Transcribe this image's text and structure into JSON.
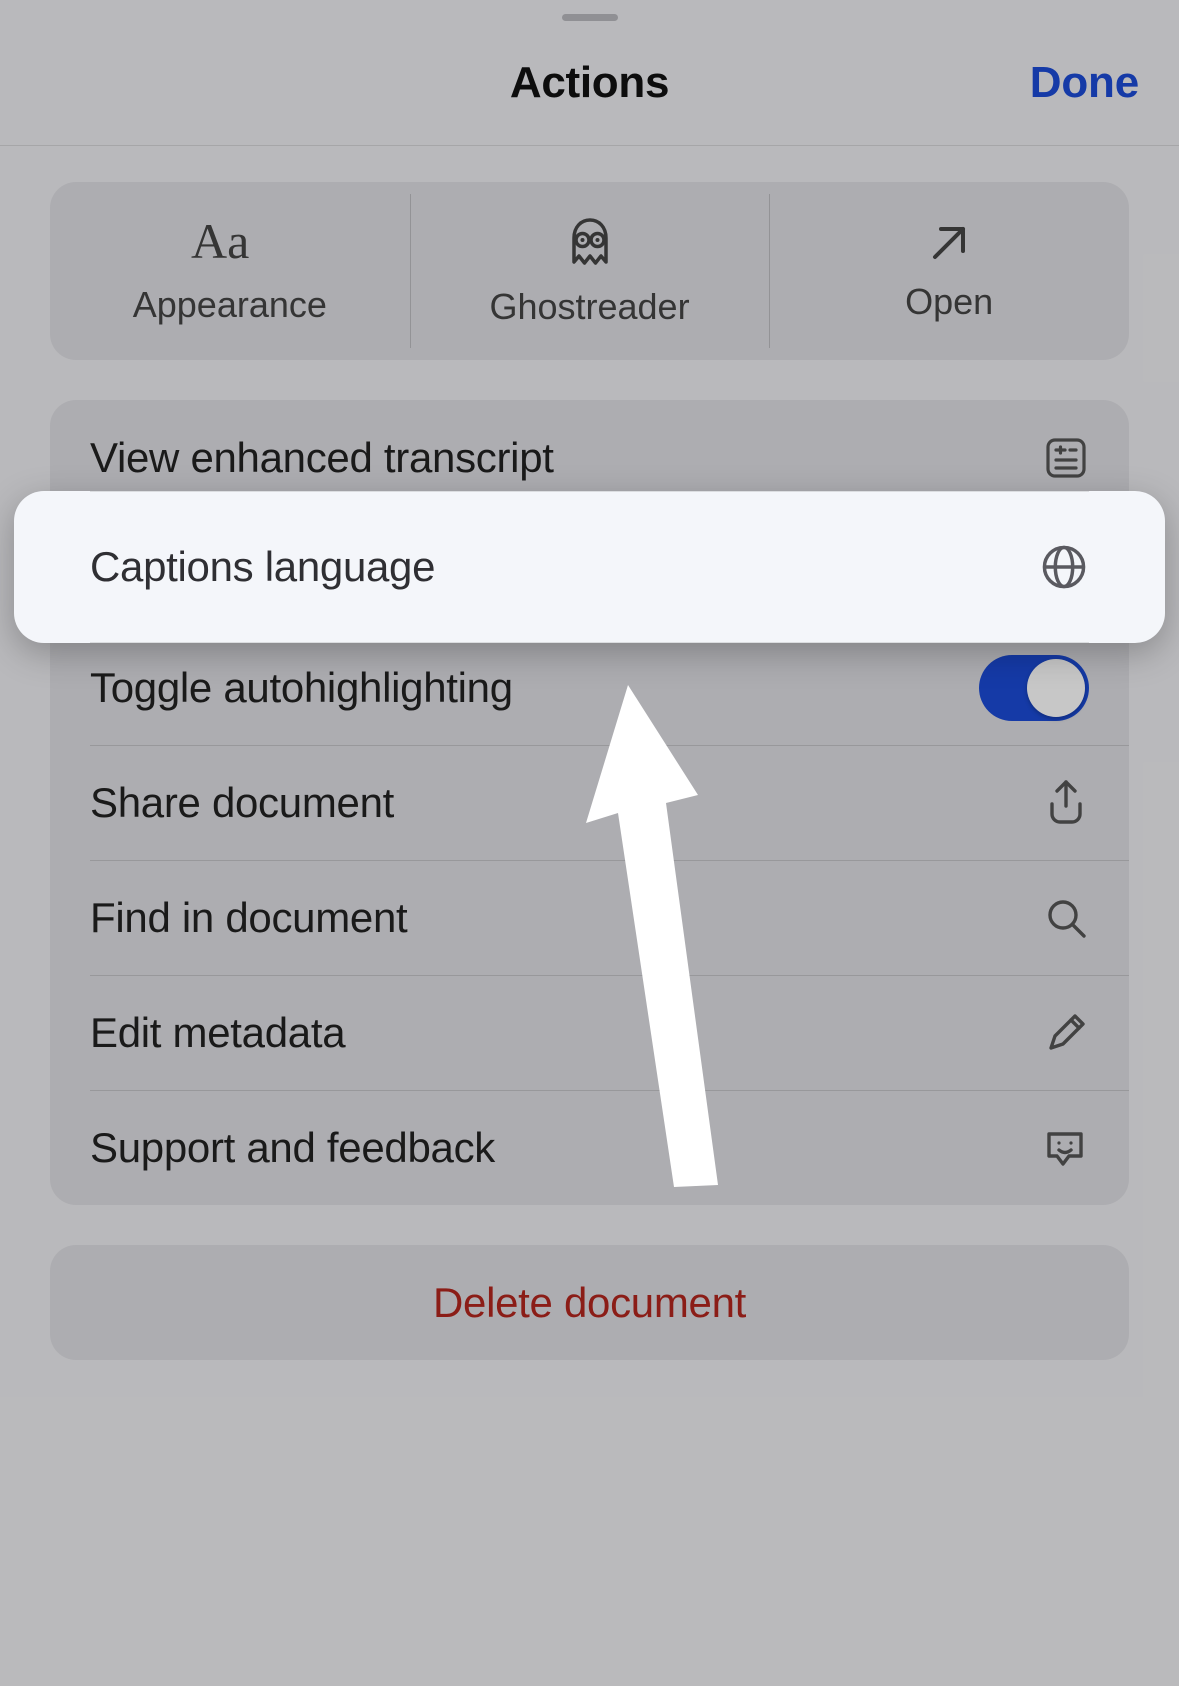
{
  "header": {
    "title": "Actions",
    "done_label": "Done"
  },
  "top_actions": [
    {
      "label": "Appearance",
      "icon": "appearance-icon"
    },
    {
      "label": "Ghostreader",
      "icon": "ghostreader-icon"
    },
    {
      "label": "Open",
      "icon": "open-icon"
    }
  ],
  "highlighted": {
    "label": "Captions language",
    "icon": "globe-icon"
  },
  "rows": [
    {
      "label": "View enhanced transcript",
      "icon": "transcript-icon",
      "type": "nav"
    },
    {
      "label": "Captions language",
      "icon": "globe-icon",
      "type": "nav",
      "highlighted": true
    },
    {
      "label": "Toggle autohighlighting",
      "icon": "switch",
      "type": "toggle",
      "on": true
    },
    {
      "label": "Share document",
      "icon": "share-icon",
      "type": "nav"
    },
    {
      "label": "Find in document",
      "icon": "search-icon",
      "type": "nav"
    },
    {
      "label": "Edit metadata",
      "icon": "pencil-icon",
      "type": "nav"
    },
    {
      "label": "Support and feedback",
      "icon": "feedback-icon",
      "type": "nav"
    }
  ],
  "destructive": {
    "delete_label": "Delete document"
  },
  "colors": {
    "accent": "#1b4bd6",
    "destructive": "#b3261e"
  }
}
